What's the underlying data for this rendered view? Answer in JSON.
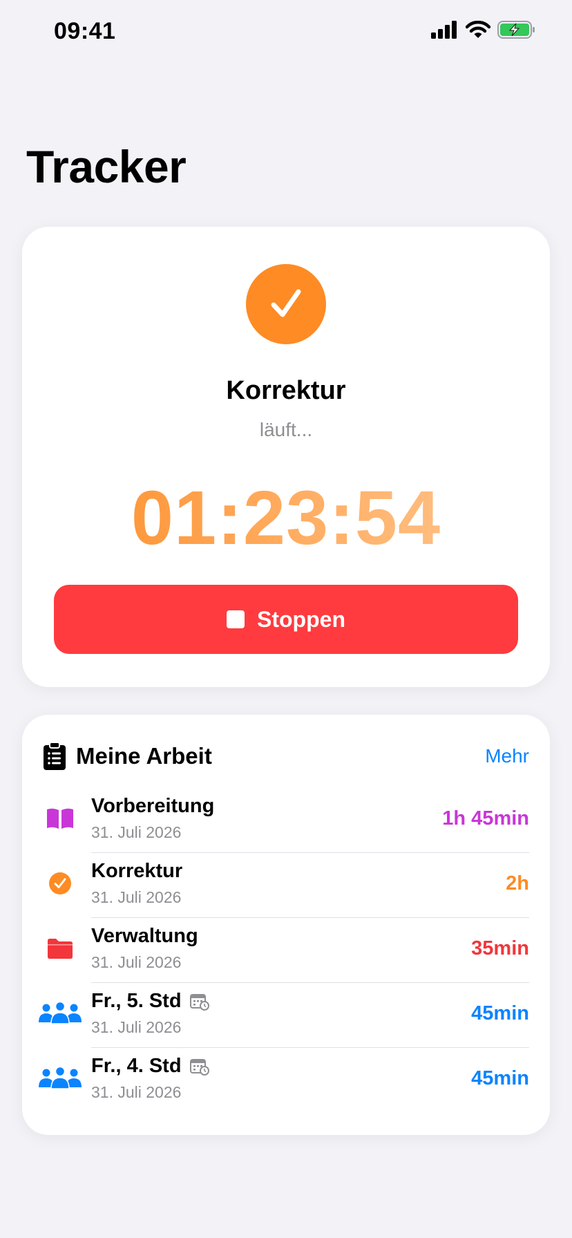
{
  "status_bar": {
    "time": "09:41"
  },
  "page": {
    "title": "Tracker"
  },
  "timer": {
    "activity": "Korrektur",
    "status": "läuft...",
    "elapsed": "01:23:54",
    "stop_label": "Stoppen",
    "accent": "#fe8b24"
  },
  "work": {
    "title": "Meine Arbeit",
    "more_label": "Mehr",
    "items": [
      {
        "title": "Vorbereitung",
        "date": "31. Juli 2026",
        "duration": "1h 45min",
        "color": "#c936d8",
        "icon": "book-icon",
        "has_calendar": false
      },
      {
        "title": "Korrektur",
        "date": "31. Juli 2026",
        "duration": "2h",
        "color": "#fe8b24",
        "icon": "check-circle-icon",
        "has_calendar": false
      },
      {
        "title": "Verwaltung",
        "date": "31. Juli 2026",
        "duration": "35min",
        "color": "#f2363b",
        "icon": "folder-icon",
        "has_calendar": false
      },
      {
        "title": "Fr., 5. Std",
        "date": "31. Juli 2026",
        "duration": "45min",
        "color": "#0a84ff",
        "icon": "people-icon",
        "has_calendar": true
      },
      {
        "title": "Fr., 4. Std",
        "date": "31. Juli 2026",
        "duration": "45min",
        "color": "#0a84ff",
        "icon": "people-icon",
        "has_calendar": true
      }
    ]
  }
}
